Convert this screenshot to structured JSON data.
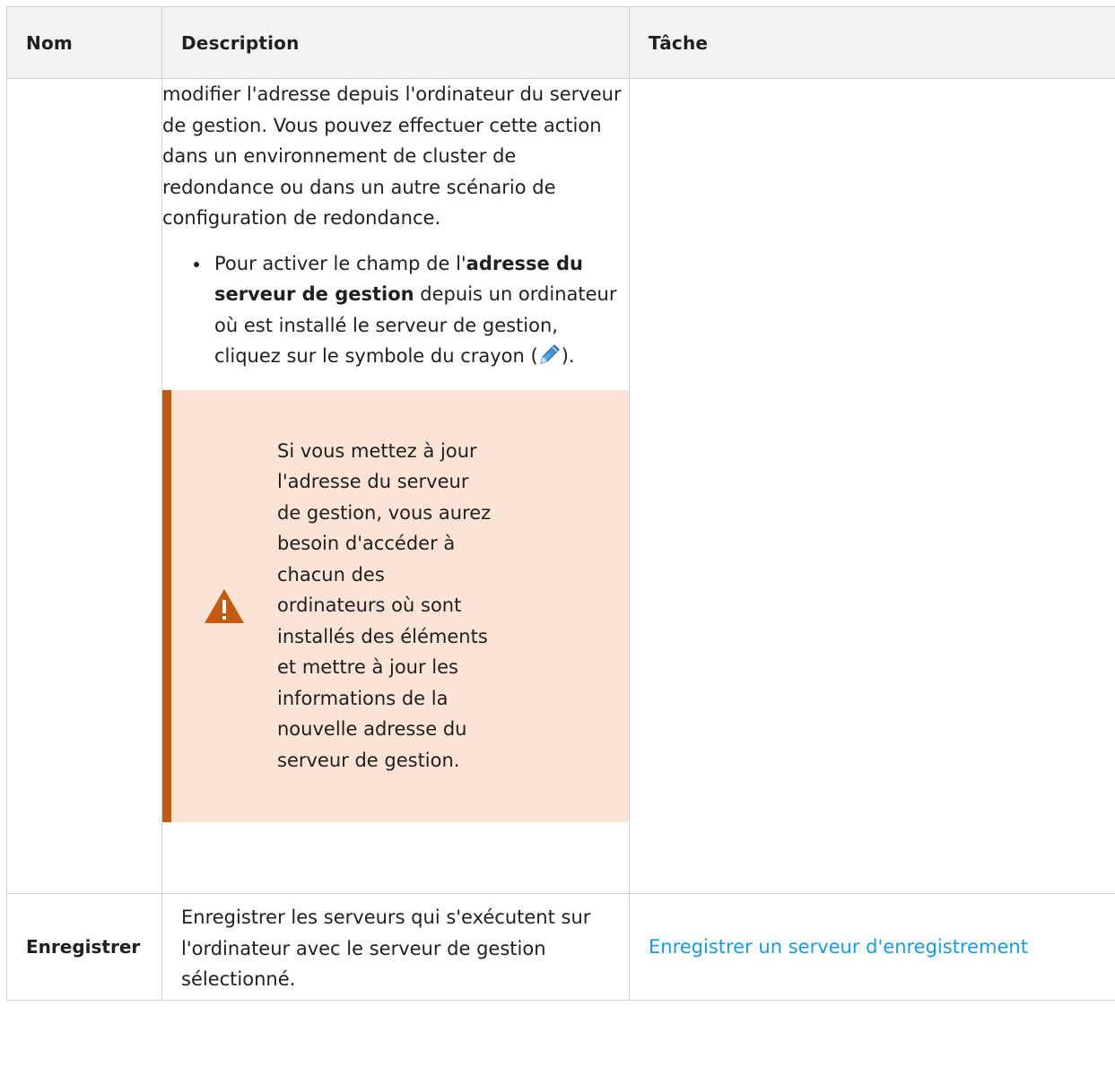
{
  "table": {
    "headers": {
      "nom": "Nom",
      "description": "Description",
      "tache": "Tâche"
    },
    "detail_row": {
      "nom": "",
      "description_paragraph": "modifier l'adresse depuis l'ordinateur du serveur de gestion. Vous pouvez effectuer cette action dans un environnement de cluster de redondance ou dans un autre scénario de configuration de redondance.",
      "bullet": {
        "prefix": "Pour activer le champ de l'",
        "bold": "adresse du serveur de gestion",
        "middle": " depuis un ordinateur où est installé le serveur de gestion, cliquez sur le symbole du crayon (",
        "icon": "pencil-icon",
        "suffix": ")."
      },
      "warning": {
        "icon": "warning-icon",
        "text": "Si vous mettez à jour l'adresse du serveur de gestion, vous aurez besoin d'accéder à chacun des ordinateurs où sont installés des éléments et mettre à jour les informations de la nouvelle adresse du serveur de gestion.",
        "accent_color": "#c55a11",
        "background_color": "#fbe3d6"
      },
      "tache": ""
    },
    "enregistrer_row": {
      "nom": "Enregistrer",
      "description": "Enregistrer les serveurs qui s'exécutent sur l'ordinateur avec le serveur de gestion sélectionné.",
      "tache_link": "Enregistrer un serveur d'enregistrement",
      "link_color": "#1a9ae0"
    }
  }
}
